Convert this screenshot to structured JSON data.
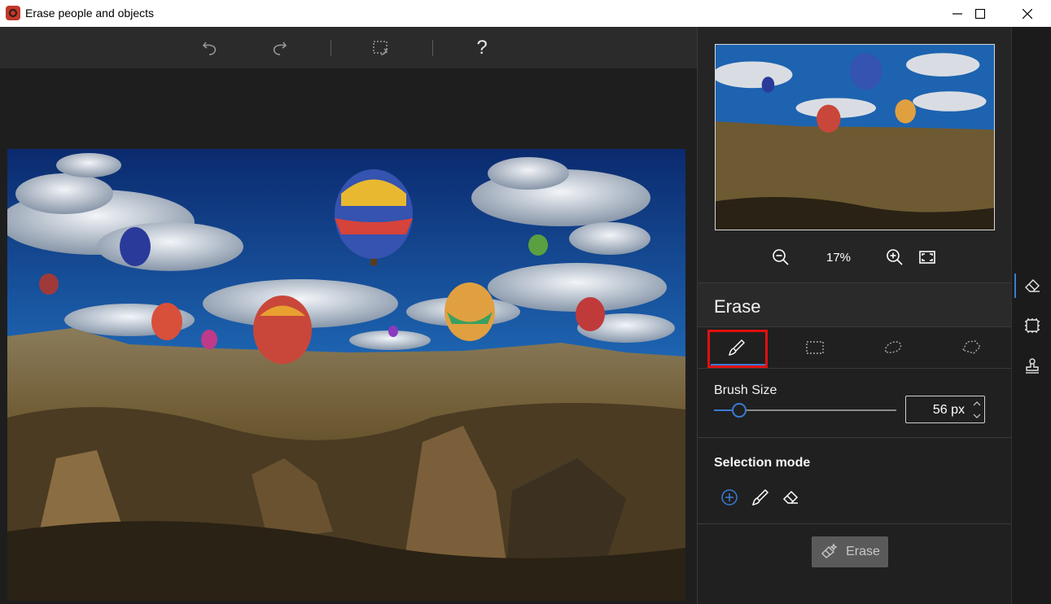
{
  "window": {
    "title": "Erase people and objects",
    "controls": [
      "minimize-icon",
      "maximize-icon",
      "close-icon"
    ]
  },
  "toolbar": {
    "undo_icon": "undo-icon",
    "redo_icon": "redo-icon",
    "crop_rotate_icon": "selection-reset-icon",
    "help_label": "?"
  },
  "preview": {
    "zoom_value": "17%",
    "zoom_out_icon": "zoom-out-icon",
    "zoom_in_icon": "zoom-in-icon",
    "fit_icon": "fit-screen-icon"
  },
  "panel": {
    "title": "Erase",
    "tools": [
      {
        "icon": "brush-icon",
        "active": true
      },
      {
        "icon": "rectangle-select-icon",
        "active": false
      },
      {
        "icon": "lasso-icon",
        "active": false
      },
      {
        "icon": "polygon-lasso-icon",
        "active": false
      }
    ],
    "brush_size_label": "Brush Size",
    "brush_size_value": "56 px",
    "brush_level": 0.14,
    "selection_mode_label": "Selection mode",
    "selection_modes": [
      "add-selection-icon",
      "brush-icon",
      "eraser-icon"
    ],
    "erase_button_label": "Erase"
  },
  "side_rail": [
    "eraser-icon",
    "frame-icon",
    "stamp-icon"
  ],
  "colors": {
    "accent": "#3a7bd5",
    "highlight": "#e01010",
    "panel": "#202020"
  }
}
